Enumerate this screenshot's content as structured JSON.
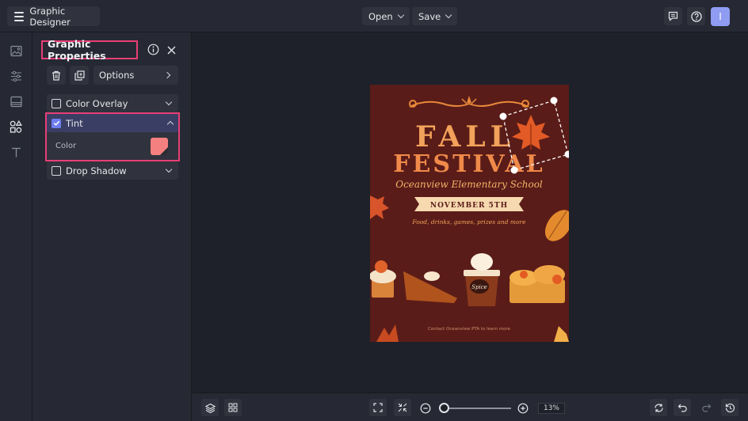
{
  "app": {
    "title": "Graphic Designer",
    "accent": "#e83e76",
    "brand": "#6e7df0"
  },
  "topbar": {
    "menu_icon": "hamburger-icon",
    "open_label": "Open",
    "save_label": "Save",
    "avatar_initial": "I"
  },
  "rail": {
    "icons": [
      "image-icon",
      "sliders-icon",
      "background-icon",
      "shapes-icon",
      "text-icon"
    ]
  },
  "panel": {
    "title": "Graphic Properties",
    "options_label": "Options",
    "sections": {
      "color_overlay": {
        "label": "Color Overlay",
        "checked": false
      },
      "tint": {
        "label": "Tint",
        "checked": true,
        "color_label": "Color",
        "color_value": "#f4807f"
      },
      "drop_shadow": {
        "label": "Drop Shadow",
        "checked": false
      }
    }
  },
  "poster": {
    "title_line1": "FALL",
    "title_line2": "FESTIVAL",
    "school": "Oceanview Elementary School",
    "date": "NOVEMBER 5TH",
    "details": "Food, drinks, games, prizes and more",
    "contact": "Contact Oceanview PTA to learn more",
    "cup_text": "Spice"
  },
  "bottombar": {
    "zoom_label": "13%",
    "zoom_level": 0.13
  }
}
